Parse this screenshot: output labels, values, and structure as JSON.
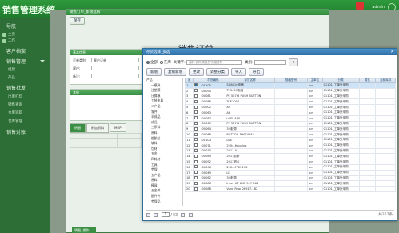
{
  "app": {
    "title": "销售管理系统",
    "user": "admin"
  },
  "sidebar": {
    "items": [
      {
        "label": "导航"
      },
      {
        "label": "主页"
      },
      {
        "label": "工作"
      },
      {
        "label": "客户档案"
      },
      {
        "label": "销售管理"
      },
      {
        "label": "组建"
      },
      {
        "label": "产品"
      },
      {
        "label": "销售批发"
      },
      {
        "label": "出库打印"
      },
      {
        "label": "销售查询"
      },
      {
        "label": "仓库追踪"
      },
      {
        "label": "仓库管理"
      },
      {
        "label": "销售对账"
      }
    ]
  },
  "dialog": {
    "title": "销售订单_新增选购",
    "save_label": "保存",
    "order_title": "销售订单",
    "basic_section": "基本信息",
    "labels": {
      "order_type": "订单类别:",
      "customer": "客户:",
      "remark": "备注:"
    },
    "order_type_value": "客户订单",
    "customer_value": "",
    "detail_section": "其他",
    "tabs": [
      "明细",
      "附加资料",
      "MRP"
    ],
    "bottom_label": "明细, 操作"
  },
  "popup": {
    "title": "存货选择_多选",
    "radio_all": "全部",
    "radio_stock": "在库",
    "keyword_label": "关键字:",
    "keyword_placeholder": "编码,名称,规格型号,描述等",
    "category_label": "类别:",
    "buttons": [
      "新增",
      "复制新增",
      "更改",
      "调整分类",
      "导入",
      "导出"
    ],
    "tree": [
      "产品",
      "一模具",
      "注塑模",
      "压铸模",
      "工装夹具",
      "二产品",
      "零件",
      "半成品",
      "成品",
      "三原料",
      "原料",
      "塑胶粒",
      "辅料",
      "包材",
      "五金",
      "四耗材",
      "工具",
      "劳保",
      "五产品",
      "原料",
      "模具",
      "五金件",
      "配件件",
      "劳保品"
    ],
    "columns": [
      "序",
      "",
      "存货编码",
      "存货名称",
      "规格型号",
      "主单位",
      "分类",
      "属性",
      "当前库存"
    ],
    "rows": [
      {
        "code": "00105",
        "name": "SD8816电器",
        "unit": "pcs",
        "cat": "01101_工单外采购"
      },
      {
        "code": "00090",
        "name": "T23453电器",
        "unit": "pcs",
        "cat": "01101_工单外采购"
      },
      {
        "code": "00081",
        "name": "PE 507-6 PUSH BUTTON",
        "unit": "pcs",
        "cat": "01101_工单外采购"
      },
      {
        "code": "00086",
        "name": "TCE2004",
        "unit": "pcs",
        "cat": "01101_工单外采购"
      },
      {
        "code": "01002",
        "name": "A2",
        "unit": "pcs",
        "cat": "01101_工单外采购"
      },
      {
        "code": "00063",
        "name": "A3",
        "unit": "pcs",
        "cat": "01101_工单外采购"
      },
      {
        "code": "00087",
        "name": "LGEL FRY",
        "unit": "pcs",
        "cat": "01101_工单外采购"
      },
      {
        "code": "00065",
        "name": "PE 507-6 PUSH BUTTON",
        "unit": "pcs",
        "cat": "01101_工单外采购"
      },
      {
        "code": "00064",
        "name": "3M胶带",
        "unit": "pcs",
        "cat": "01101_工单外采购"
      },
      {
        "code": "00068",
        "name": "BUTTON-16074545",
        "unit": "pcs",
        "cat": "01101_工单外采购"
      },
      {
        "code": "00103",
        "name": "LGE",
        "unit": "pcs",
        "cat": "01101_工单外采购"
      },
      {
        "code": "00071",
        "name": "2204-Housing",
        "unit": "pcs",
        "cat": "01101_工单外采购"
      },
      {
        "code": "00070",
        "name": "2011-A",
        "unit": "pcs",
        "cat": "01101_工单外采购"
      },
      {
        "code": "00069",
        "name": "2011胶条",
        "unit": "pcs",
        "cat": "01101_工单外采购"
      },
      {
        "code": "00092",
        "name": "2011铁片",
        "unit": "pcs",
        "cat": "01101_工单外采购"
      },
      {
        "code": "00096",
        "name": "2204-FP22136",
        "unit": "pcs",
        "cat": "01101_工单外采购"
      },
      {
        "code": "00049",
        "name": "LK",
        "unit": "pcs",
        "cat": "01101_工单外采购"
      },
      {
        "code": "00062",
        "name": "3M胶带",
        "unit": "pcs",
        "cat": "01101_工单外采购"
      },
      {
        "code": "00086",
        "name": "Inner UT LHD 517 564",
        "unit": "pcs",
        "cat": "01101_工单外采购"
      },
      {
        "code": "00088",
        "name": "Vane Rear 26917-182",
        "unit": "pcs",
        "cat": "01101_工单外采购"
      }
    ],
    "pager": {
      "page": "1",
      "total": "/ 52",
      "info": "共257条"
    }
  }
}
